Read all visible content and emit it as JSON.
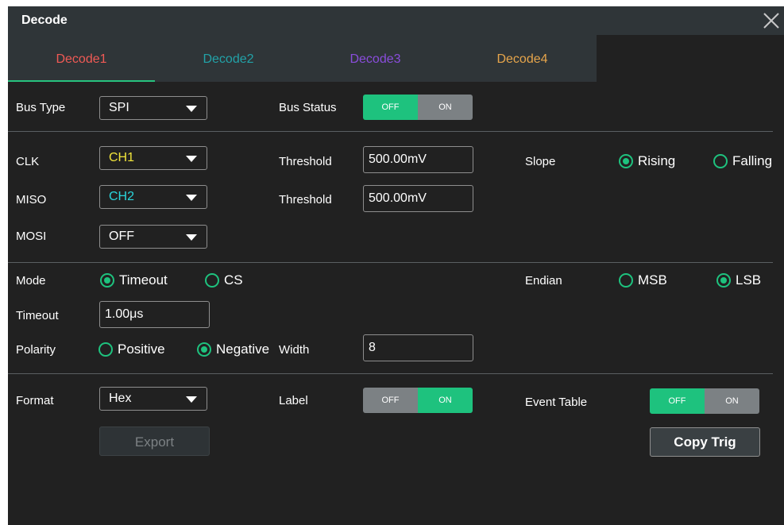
{
  "window": {
    "title": "Decode",
    "close_icon": "close-icon"
  },
  "tabs": [
    {
      "label": "Decode1",
      "color": "#f05a55",
      "active": true
    },
    {
      "label": "Decode2",
      "color": "#22a2a8",
      "active": false
    },
    {
      "label": "Decode3",
      "color": "#8a4ddc",
      "active": false
    },
    {
      "label": "Decode4",
      "color": "#e6a54b",
      "active": false
    }
  ],
  "bus": {
    "type_label": "Bus Type",
    "type_value": "SPI",
    "status_label": "Bus Status",
    "status_off": "OFF",
    "status_on": "ON",
    "status_state": "OFF"
  },
  "channels": {
    "clk_label": "CLK",
    "clk_value": "CH1",
    "clk_color": "#f0e43b",
    "clk_threshold_label": "Threshold",
    "clk_threshold_value": "500.00mV",
    "miso_label": "MISO",
    "miso_value": "CH2",
    "miso_color": "#2ad6dc",
    "miso_threshold_label": "Threshold",
    "miso_threshold_value": "500.00mV",
    "mosi_label": "MOSI",
    "mosi_value": "OFF",
    "slope_label": "Slope",
    "slope_rising": "Rising",
    "slope_falling": "Falling",
    "slope_selected": "Rising"
  },
  "mode": {
    "mode_label": "Mode",
    "timeout_option": "Timeout",
    "cs_option": "CS",
    "mode_selected": "Timeout",
    "endian_label": "Endian",
    "msb": "MSB",
    "lsb": "LSB",
    "endian_selected": "LSB",
    "timeout_label": "Timeout",
    "timeout_value": "1.00μs",
    "polarity_label": "Polarity",
    "positive": "Positive",
    "negative": "Negative",
    "polarity_selected": "Negative",
    "width_label": "Width",
    "width_value": "8"
  },
  "display": {
    "format_label": "Format",
    "format_value": "Hex",
    "label_label": "Label",
    "label_off": "OFF",
    "label_on": "ON",
    "label_state": "ON",
    "event_table_label": "Event Table",
    "event_off": "OFF",
    "event_on": "ON",
    "event_state": "OFF",
    "export_label": "Export",
    "copy_trig_label": "Copy Trig"
  },
  "colors": {
    "accent": "#1ec27e",
    "panel": "#212121",
    "header": "#2f3538"
  }
}
